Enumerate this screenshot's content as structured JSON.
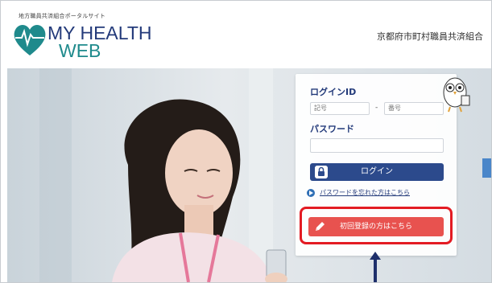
{
  "header": {
    "tagline": "地方職員共済組合ポータルサイト",
    "logo_line1": "MY HEALTH",
    "logo_line2": "WEB",
    "org_name": "京都府市町村職員共済組合"
  },
  "login": {
    "id_label": "ログインID",
    "id_part1_placeholder": "記号",
    "id_sep": "-",
    "id_part2_placeholder": "番号",
    "password_label": "パスワード",
    "login_button": "ログイン",
    "forgot_link": "パスワードを忘れた方はこちら",
    "register_button": "初回登録の方はこちら"
  },
  "colors": {
    "brand_blue": "#2c4a8c",
    "logo_heart": "#1f8a8c",
    "register_red": "#e8524f",
    "highlight_red": "#e31b23"
  }
}
